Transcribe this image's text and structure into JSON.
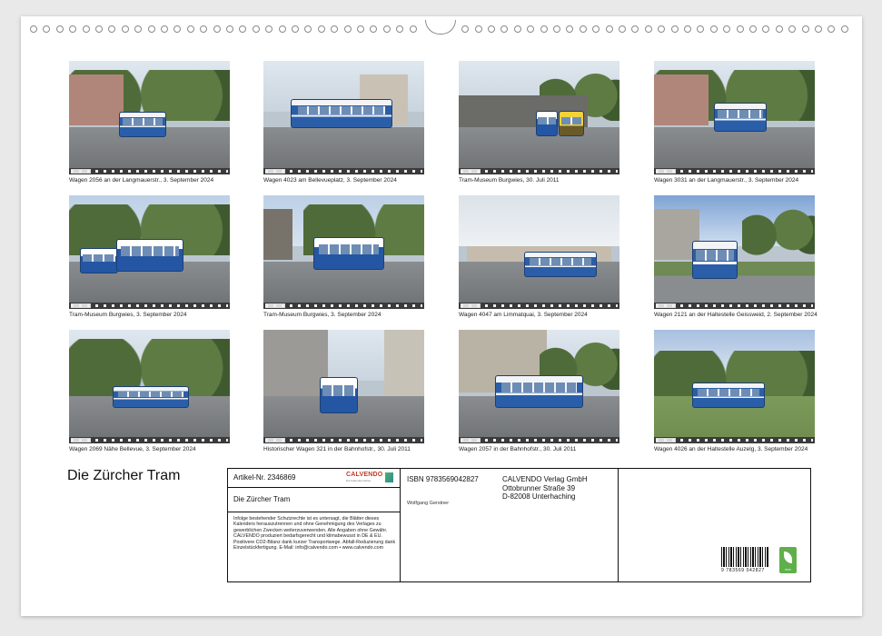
{
  "photos": [
    {
      "caption": "Wagen 2056 an der Langmauerstr., 3. September 2024"
    },
    {
      "caption": "Wagen 4023 am Bellevueplatz, 3. September 2024"
    },
    {
      "caption": "Tram-Museum Burgwies, 30. Juli 2011"
    },
    {
      "caption": "Wagen 3031 an der Langmauerstr., 3. September 2024"
    },
    {
      "caption": "Tram-Museum Burgwies, 3. September 2024"
    },
    {
      "caption": "Tram-Museum Burgwies, 3. September 2024"
    },
    {
      "caption": "Wagen 4047 am Limmatquai, 3. September 2024"
    },
    {
      "caption": "Wagen 2121 an der Haltestelle Geissweid,  2. September 2024"
    },
    {
      "caption": "Wagen 2069 Nähe Bellevue, 3. September 2024"
    },
    {
      "caption": "Historischer Wagen 321 in der Bahnhofstr., 30. Juli 2011"
    },
    {
      "caption": "Wagen 2057 in der Bahnhofstr., 30. Juli 2011"
    },
    {
      "caption": "Wagen 4026 an der Haltestelle Auzelg, 3. September 2024"
    }
  ],
  "calendar": {
    "title": "Die Zürcher Tram",
    "article": "Artikel-Nr. 2346869",
    "brand": "CALVENDO",
    "brand_tagline": "Die Kalendermacher",
    "subtitle": "Die Zürcher Tram",
    "legal": "Infolge bestehender Schutzrechte ist es untersagt, die Blätter dieses Kalenders herauszutrennen und ohne Genehmigung des Verlages zu gewerblichen Zwecken weiterzuverwenden. Alle Angaben ohne Gewähr. CALVENDO produziert bedarfsgerecht und klimabewusst in DE & EU. Positivere CO2-Bilanz dank kurzer Transportwege. Abfall-Reduzierung dank Einzelstückfertigung. E-Mail: info@calvendo.com • www.calvendo.com",
    "isbn": "ISBN 9783569042827",
    "publisher_lines": [
      "CALVENDO Verlag GmbH",
      "Ottobrunner Straße 39",
      "D-82008 Unterhaching"
    ],
    "author": "Wolfgang Gerstner",
    "barcode_digits": "9 783569 042827",
    "eco_label": "eco"
  }
}
